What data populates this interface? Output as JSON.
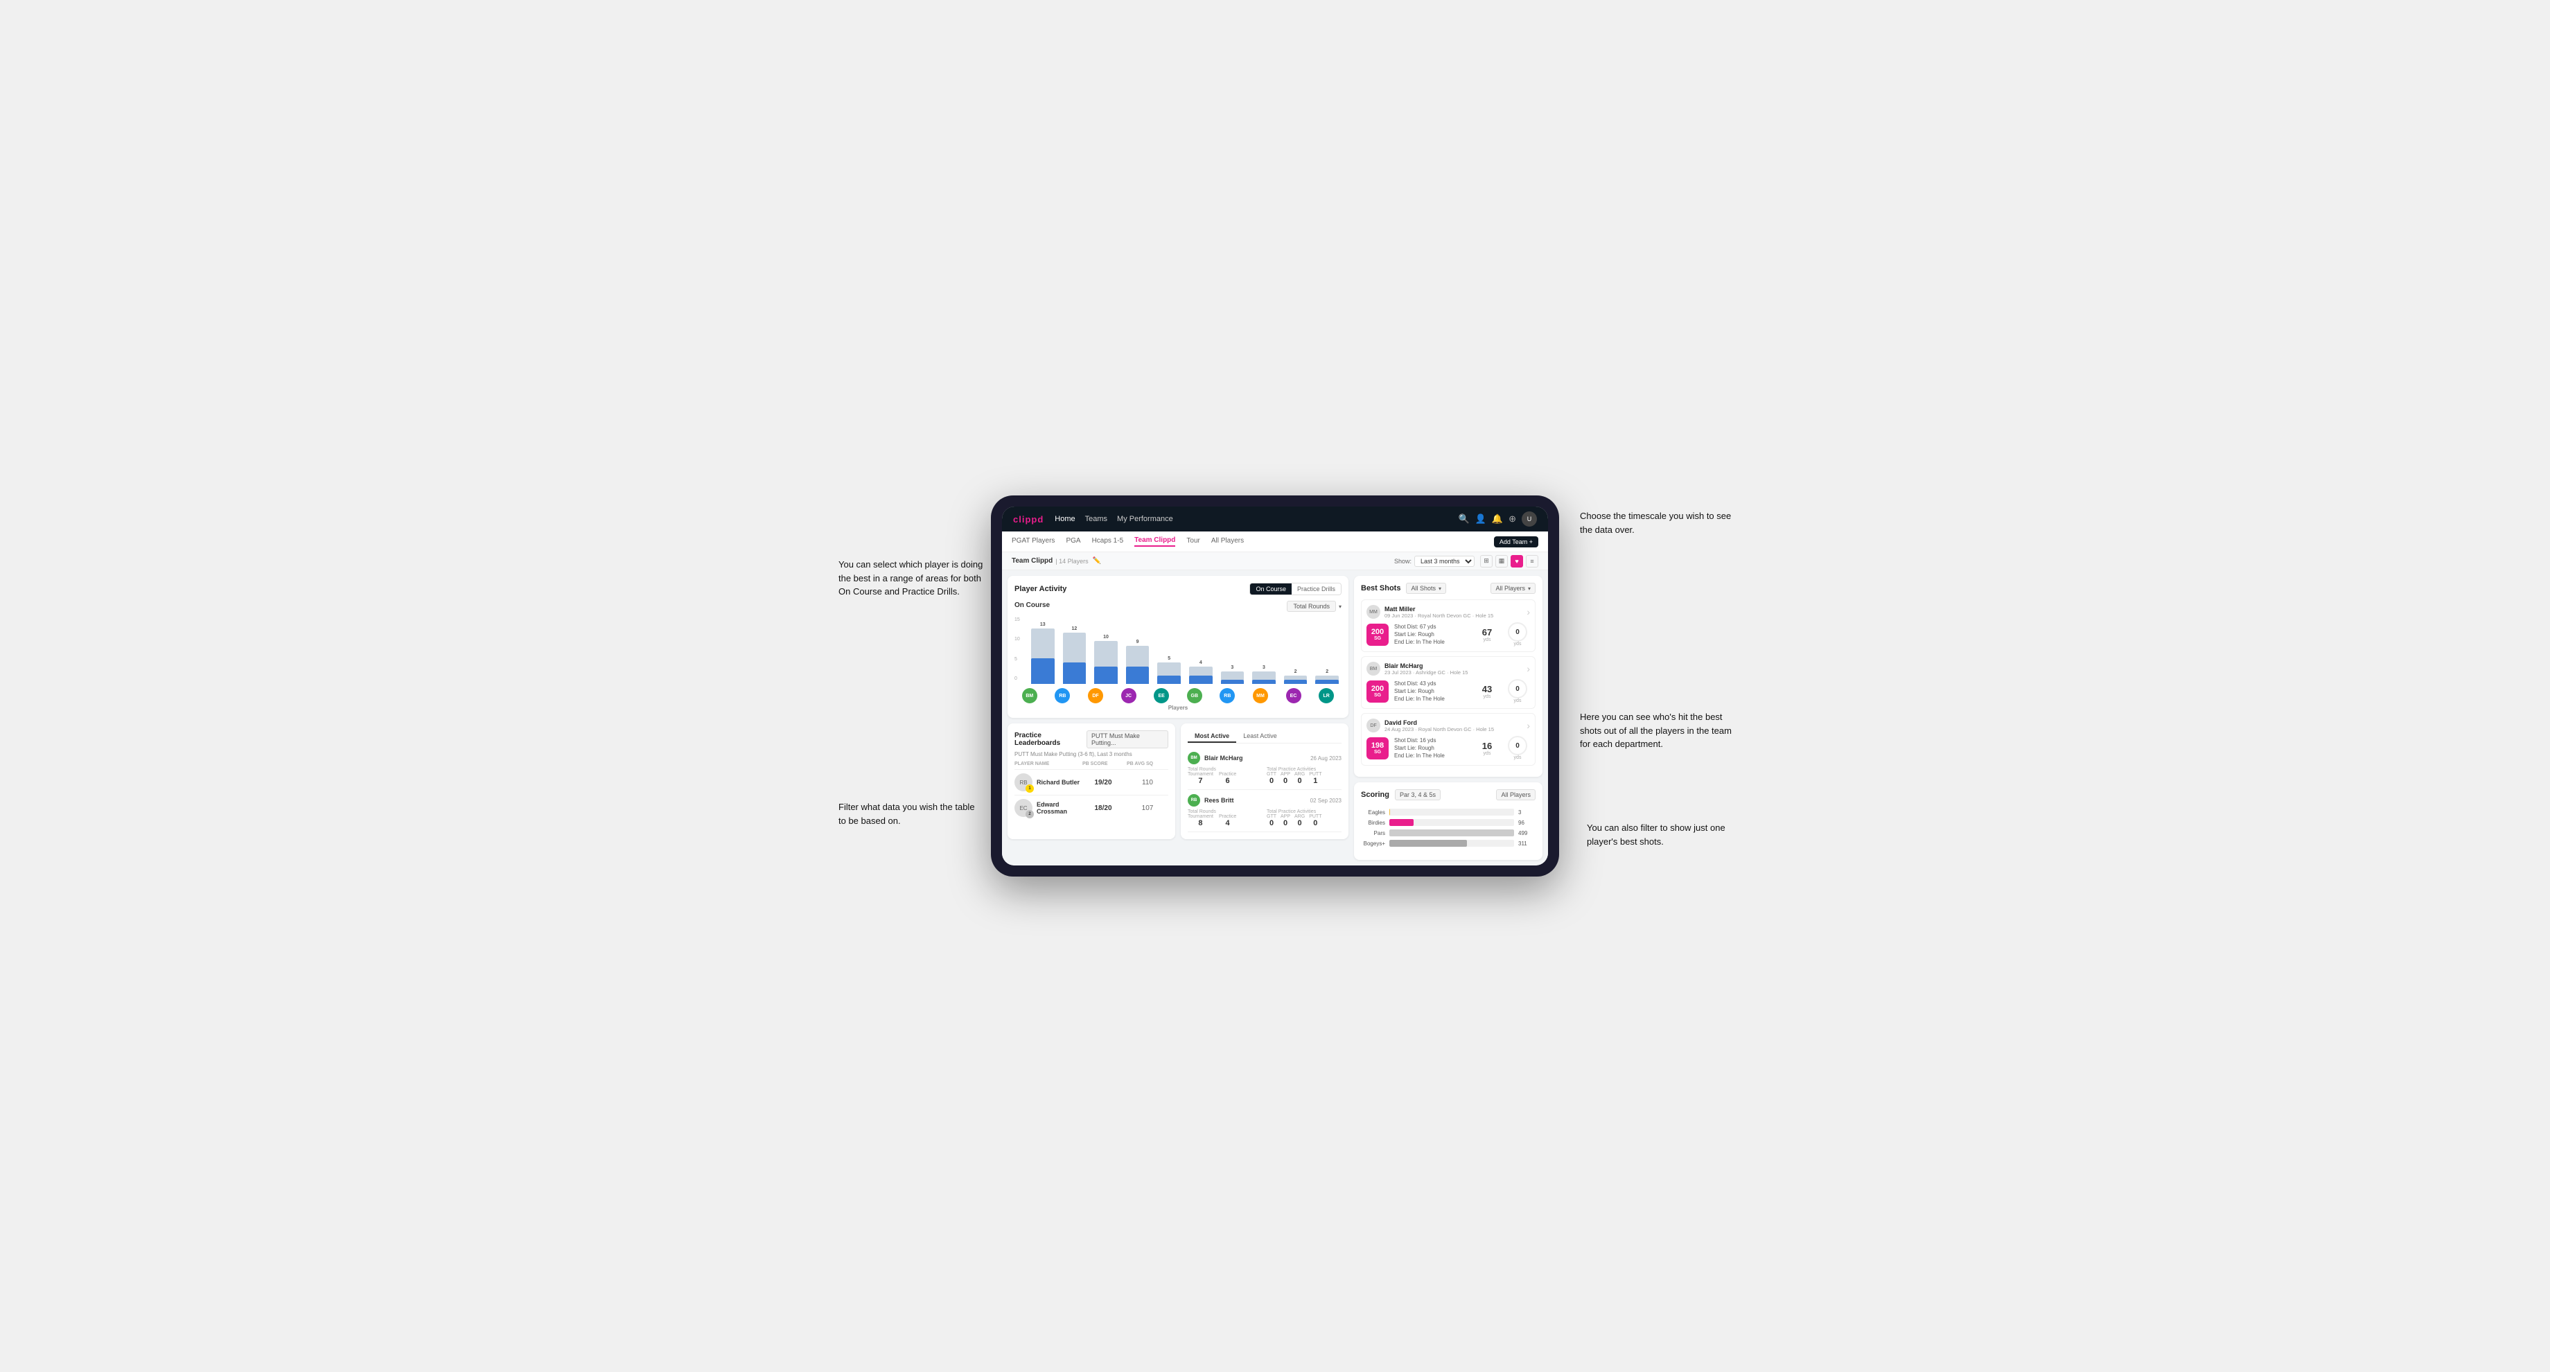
{
  "app": {
    "logo": "clippd",
    "nav": {
      "links": [
        "Home",
        "Teams",
        "My Performance"
      ],
      "icons": [
        "search",
        "people",
        "bell",
        "add-circle",
        "avatar"
      ]
    },
    "sub_nav": {
      "items": [
        "PGAT Players",
        "PGA",
        "Hcaps 1-5",
        "Team Clippd",
        "Tour",
        "All Players"
      ],
      "active": "Team Clippd",
      "add_btn": "Add Team +"
    }
  },
  "team_header": {
    "name": "Team Clippd",
    "count": "| 14 Players",
    "show_label": "Show:",
    "show_value": "Last 3 months",
    "view_icons": [
      "grid",
      "tile",
      "heart",
      "list"
    ]
  },
  "player_activity": {
    "title": "Player Activity",
    "toggle": [
      "On Course",
      "Practice Drills"
    ],
    "active_toggle": "On Course",
    "section_title": "On Course",
    "filter_label": "Total Rounds",
    "y_labels": [
      "15",
      "10",
      "5",
      "0"
    ],
    "y_axis_title": "Total Rounds",
    "bars": [
      {
        "name": "B. McHarg",
        "value": 13,
        "highlight": 6
      },
      {
        "name": "R. Britt",
        "value": 12,
        "highlight": 5
      },
      {
        "name": "D. Ford",
        "value": 10,
        "highlight": 4
      },
      {
        "name": "J. Coles",
        "value": 9,
        "highlight": 4
      },
      {
        "name": "E. Ebert",
        "value": 5,
        "highlight": 2
      },
      {
        "name": "G. Billingham",
        "value": 4,
        "highlight": 2
      },
      {
        "name": "R. Butler",
        "value": 3,
        "highlight": 1
      },
      {
        "name": "M. Miller",
        "value": 3,
        "highlight": 1
      },
      {
        "name": "E. Crossman",
        "value": 2,
        "highlight": 1
      },
      {
        "name": "L. Robertson",
        "value": 2,
        "highlight": 1
      }
    ],
    "x_label": "Players"
  },
  "practice_leaderboards": {
    "title": "Practice Leaderboards",
    "filter": "PUTT Must Make Putting...",
    "subtitle": "PUTT Must Make Putting (3-6 ft), Last 3 months",
    "col_headers": [
      "PLAYER NAME",
      "PB SCORE",
      "PB AVG SQ"
    ],
    "players": [
      {
        "name": "Richard Butler",
        "rank": 1,
        "pb_score": "19/20",
        "pb_avg": "110",
        "initials": "RB",
        "color": "blue"
      },
      {
        "name": "Edward Crossman",
        "rank": 2,
        "pb_score": "18/20",
        "pb_avg": "107",
        "initials": "EC",
        "color": "teal"
      }
    ]
  },
  "most_active": {
    "tabs": [
      "Most Active",
      "Least Active"
    ],
    "active_tab": "Most Active",
    "players": [
      {
        "name": "Blair McHarg",
        "date": "26 Aug 2023",
        "total_rounds_label": "Total Rounds",
        "tournament": 7,
        "practice": 6,
        "total_practice_label": "Total Practice Activities",
        "gtt": 0,
        "app": 0,
        "arg": 0,
        "putt": 1
      },
      {
        "name": "Rees Britt",
        "date": "02 Sep 2023",
        "total_rounds_label": "Total Rounds",
        "tournament": 8,
        "practice": 4,
        "total_practice_label": "Total Practice Activities",
        "gtt": 0,
        "app": 0,
        "arg": 0,
        "putt": 0
      }
    ]
  },
  "best_shots": {
    "title": "Best Shots",
    "filter": "All Shots",
    "players_filter": "All Players",
    "shots": [
      {
        "player": "Matt Miller",
        "date": "09 Jun 2023",
        "course": "Royal North Devon GC",
        "hole": "Hole 15",
        "badge_num": "200",
        "badge_label": "SG",
        "shot_dist": "Shot Dist: 67 yds",
        "start_lie": "Start Lie: Rough",
        "end_lie": "End Lie: In The Hole",
        "metric1_val": "67",
        "metric1_unit": "yds",
        "metric2_val": "0",
        "metric2_unit": "yds",
        "initials": "MM",
        "color": "blue"
      },
      {
        "player": "Blair McHarg",
        "date": "23 Jul 2023",
        "course": "Ashridge GC",
        "hole": "Hole 15",
        "badge_num": "200",
        "badge_label": "SG",
        "shot_dist": "Shot Dist: 43 yds",
        "start_lie": "Start Lie: Rough",
        "end_lie": "End Lie: In The Hole",
        "metric1_val": "43",
        "metric1_unit": "yds",
        "metric2_val": "0",
        "metric2_unit": "yds",
        "initials": "BM",
        "color": "green"
      },
      {
        "player": "David Ford",
        "date": "24 Aug 2023",
        "course": "Royal North Devon GC",
        "hole": "Hole 15",
        "badge_num": "198",
        "badge_label": "SG",
        "shot_dist": "Shot Dist: 16 yds",
        "start_lie": "Start Lie: Rough",
        "end_lie": "End Lie: In The Hole",
        "metric1_val": "16",
        "metric1_unit": "yds",
        "metric2_val": "0",
        "metric2_unit": "yds",
        "initials": "DF",
        "color": "orange"
      }
    ]
  },
  "scoring": {
    "title": "Scoring",
    "filter": "Par 3, 4 & 5s",
    "players_filter": "All Players",
    "bars": [
      {
        "label": "Eagles",
        "value": 3,
        "max": 499,
        "color": "#f0c040",
        "display": "3"
      },
      {
        "label": "Birdies",
        "value": 96,
        "max": 499,
        "color": "#e91e8c",
        "display": "96"
      },
      {
        "label": "Pars",
        "value": 499,
        "max": 499,
        "color": "#ccc",
        "display": "499"
      },
      {
        "label": "Bogeys+",
        "value": 311,
        "max": 499,
        "color": "#aaa",
        "display": "311"
      }
    ]
  },
  "annotations": {
    "top_left": "You can select which player is doing the best in a range of areas for both On Course and Practice Drills.",
    "bottom_left": "Filter what data you wish the table to be based on.",
    "top_right": "Choose the timescale you wish to see the data over.",
    "mid_right": "Here you can see who's hit the best shots out of all the players in the team for each department.",
    "bot_right": "You can also filter to show just one player's best shots."
  }
}
